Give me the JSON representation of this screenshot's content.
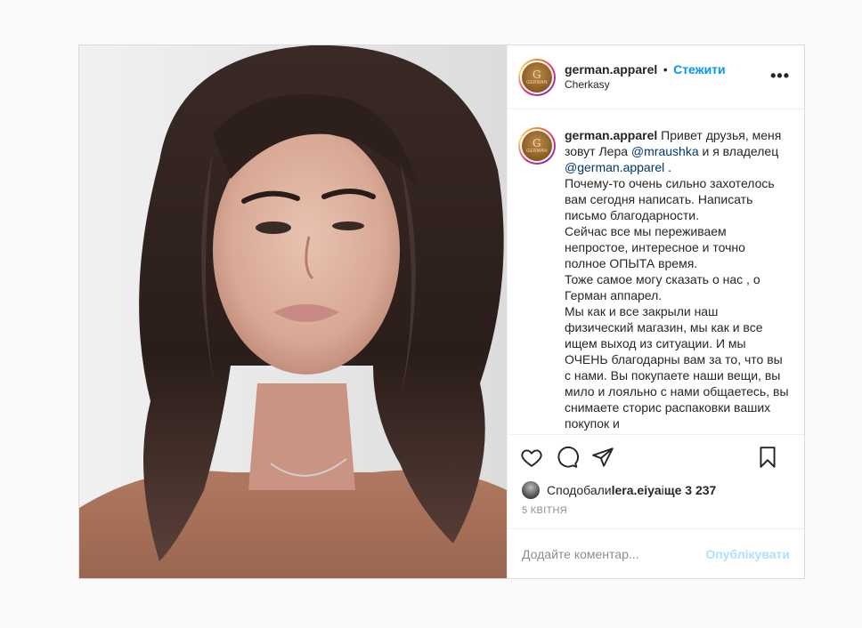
{
  "post": {
    "username": "german.apparel",
    "follow_label": "Стежити",
    "location": "Cherkasy",
    "more_label": "•••",
    "avatar_text": "GERMAN",
    "caption": {
      "username": "german.apparel",
      "part1": " Привет друзья, меня зовут Лера ",
      "mention1": "@mraushka",
      "part2": " и я владелец ",
      "mention2": "@german.apparel",
      "part3": " .",
      "lines": [
        "Почему-то очень сильно захотелось вам сегодня написать. Написать письмо благодарности.",
        "Сейчас все мы переживаем непростое, интересное и точно полное ОПЫТА время.",
        "Тоже самое могу сказать о нас , о Герман аппарел.",
        "Мы как и все закрыли наш физический магазин, мы как и все ищем выход из ситуации. И мы ОЧЕНЬ благодарны вам за то, что вы с нами. Вы покупаете наши вещи, вы мило и лояльно с нами общаетесь, вы снимаете сторис распаковки ваших покупок и"
      ]
    },
    "likes": {
      "prefix": "Сподобали ",
      "user": "lera.eiya",
      "middle": " і ",
      "count": "ще 3 237"
    },
    "date": "5 КВІТНЯ",
    "comment_placeholder": "Додайте коментар...",
    "publish_label": "Опублікувати"
  },
  "icons": {
    "like": "heart-icon",
    "comment": "comment-icon",
    "share": "paper-plane-icon",
    "save": "bookmark-icon"
  },
  "colors": {
    "accent": "#0095f6",
    "publish_disabled": "#b2dffc",
    "mention": "#00376b",
    "muted": "#8e8e8e"
  }
}
